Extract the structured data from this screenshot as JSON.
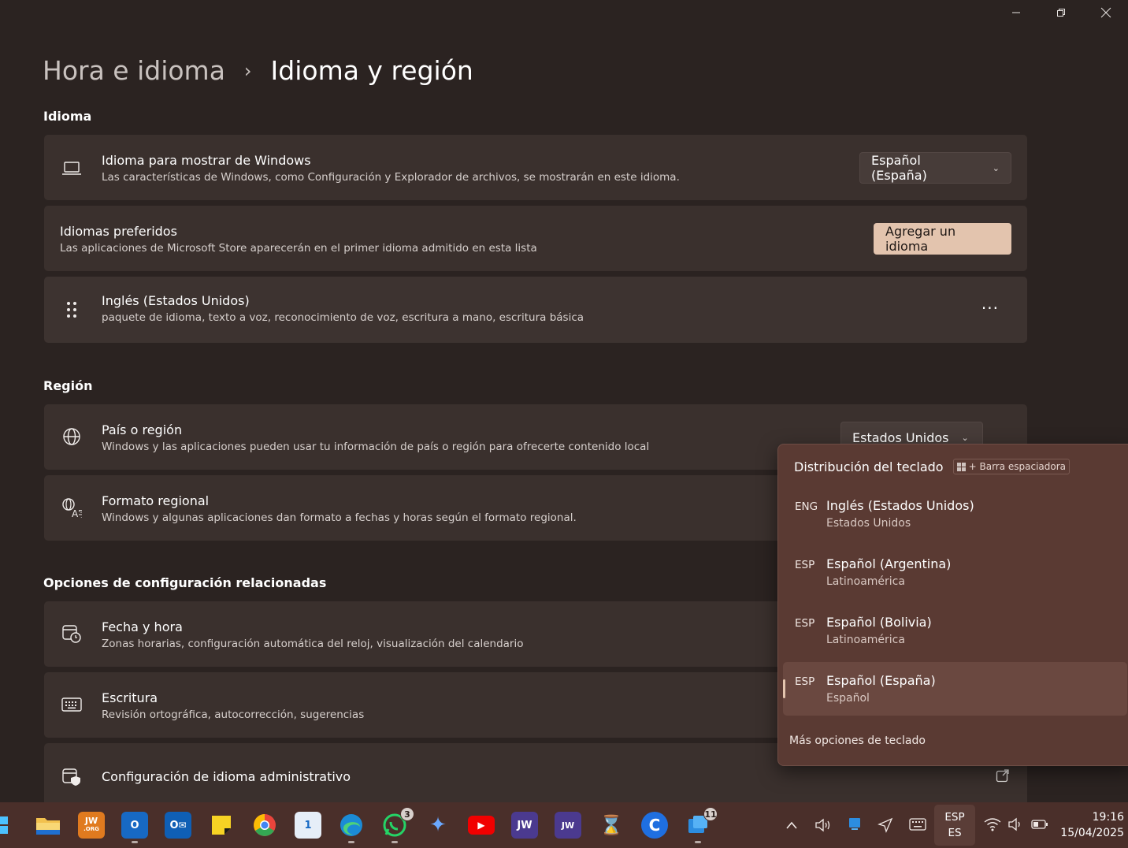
{
  "breadcrumb": {
    "parent": "Hora e idioma",
    "separator": "›",
    "current": "Idioma y región"
  },
  "sections": {
    "language": "Idioma",
    "region": "Región",
    "related": "Opciones de configuración relacionadas"
  },
  "display_language": {
    "title": "Idioma para mostrar de Windows",
    "description": "Las características de Windows, como Configuración y Explorador de archivos, se mostrarán en este idioma.",
    "selected": "Español (España)",
    "icon": "laptop-icon"
  },
  "preferred_languages": {
    "title": "Idiomas preferidos",
    "description": "Las aplicaciones de Microsoft Store aparecerán en el primer idioma admitido en esta lista",
    "add_button": "Agregar un idioma"
  },
  "installed_language": {
    "title": "Inglés (Estados Unidos)",
    "description": "paquete de idioma, texto a voz, reconocimiento de voz, escritura a mano, escritura básica",
    "more": "···",
    "icon": "drag-handle-icon"
  },
  "country_region": {
    "title": "País o región",
    "description": "Windows y las aplicaciones pueden usar tu información de país o región para ofrecerte contenido local",
    "selected": "Estados Unidos",
    "icon": "globe-icon"
  },
  "regional_format": {
    "title": "Formato regional",
    "description": "Windows y algunas aplicaciones dan formato a fechas y horas según el formato regional.",
    "icon": "language-format-icon"
  },
  "date_time": {
    "title": "Fecha y hora",
    "description": "Zonas horarias, configuración automática del reloj, visualización del calendario",
    "icon": "calendar-clock-icon"
  },
  "typing": {
    "title": "Escritura",
    "description": "Revisión ortográfica, autocorrección, sugerencias",
    "icon": "keyboard-icon"
  },
  "admin_language": {
    "title": "Configuración de idioma administrativo",
    "icon": "shield-calendar-icon"
  },
  "keyboard_flyout": {
    "title": "Distribución del teclado",
    "shortcut_plus": "+",
    "shortcut_key": "Barra espaciadora",
    "items": [
      {
        "code": "ENG",
        "name": "Inglés (Estados Unidos)",
        "region": "Estados Unidos",
        "selected": false
      },
      {
        "code": "ESP",
        "name": "Español (Argentina)",
        "region": "Latinoamérica",
        "selected": false
      },
      {
        "code": "ESP",
        "name": "Español (Bolivia)",
        "region": "Latinoamérica",
        "selected": false
      },
      {
        "code": "ESP",
        "name": "Español (España)",
        "region": "Español",
        "selected": true
      }
    ],
    "more_options": "Más opciones de teclado"
  },
  "taskbar": {
    "apps": [
      {
        "name": "file-explorer",
        "label": "",
        "color": "#f2c14e"
      },
      {
        "name": "jw-org",
        "label": "JW",
        "color": "#e07a1f"
      },
      {
        "name": "outlook-new",
        "label": "O",
        "color": "#1769c4"
      },
      {
        "name": "outlook",
        "label": "O",
        "color": "#0f5fb5"
      },
      {
        "name": "sticky-notes",
        "label": "",
        "color": "#f7d324"
      },
      {
        "name": "chrome",
        "label": "",
        "color": "#e8453c"
      },
      {
        "name": "calendar",
        "label": "1",
        "color": "#e6eef8"
      },
      {
        "name": "edge",
        "label": "",
        "color": "#1b8bd6"
      },
      {
        "name": "whatsapp",
        "label": "",
        "color": "#25d366",
        "badge": "3"
      },
      {
        "name": "copilot",
        "label": "✦",
        "color": "#4a2f2a"
      },
      {
        "name": "youtube",
        "label": "▶",
        "color": "#f10000"
      },
      {
        "name": "jw-library",
        "label": "JW",
        "color": "#4b3a8f"
      },
      {
        "name": "jw-library-sign",
        "label": "JW",
        "color": "#4b3a8f"
      },
      {
        "name": "hourglass",
        "label": "⌛",
        "color": "#4a2f2a"
      },
      {
        "name": "ccleaner",
        "label": "C",
        "color": "#1f6fe0"
      },
      {
        "name": "task-app",
        "label": "",
        "color": "#2c8de0",
        "badge": "11"
      }
    ],
    "language": {
      "line1": "ESP",
      "line2": "ES"
    },
    "time": "19:16",
    "date": "15/04/2025"
  }
}
